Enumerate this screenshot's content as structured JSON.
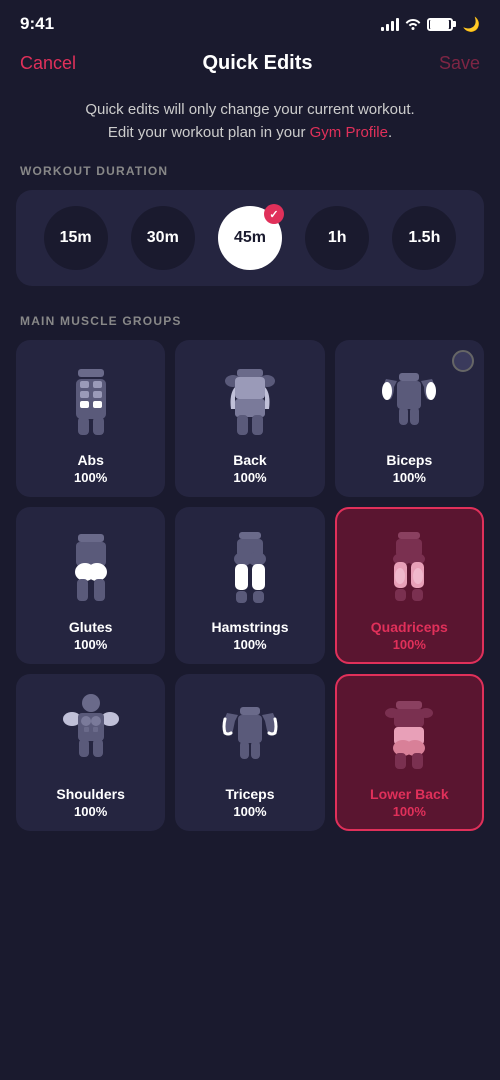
{
  "statusBar": {
    "time": "9:41",
    "moonSymbol": "🌙"
  },
  "nav": {
    "cancelLabel": "Cancel",
    "title": "Quick Edits",
    "saveLabel": "Save"
  },
  "infoText": {
    "line1": "Quick edits will only change your current workout.",
    "line2": "Edit your workout plan in your ",
    "linkText": "Gym Profile",
    "line3": "."
  },
  "workoutDuration": {
    "sectionLabel": "WORKOUT DURATION",
    "options": [
      {
        "label": "15m",
        "active": false
      },
      {
        "label": "30m",
        "active": false
      },
      {
        "label": "45m",
        "active": true
      },
      {
        "label": "1h",
        "active": false
      },
      {
        "label": "1.5h",
        "active": false
      }
    ]
  },
  "mainMuscleGroups": {
    "sectionLabel": "MAIN MUSCLE GROUPS",
    "muscles": [
      {
        "name": "Abs",
        "percent": "100%",
        "selected": false,
        "type": "abs"
      },
      {
        "name": "Back",
        "percent": "100%",
        "selected": false,
        "type": "back"
      },
      {
        "name": "Biceps",
        "percent": "100%",
        "selected": false,
        "type": "biceps",
        "showDot": true
      },
      {
        "name": "Glutes",
        "percent": "100%",
        "selected": false,
        "type": "glutes"
      },
      {
        "name": "Hamstrings",
        "percent": "100%",
        "selected": false,
        "type": "hamstrings"
      },
      {
        "name": "Quadriceps",
        "percent": "100%",
        "selected": true,
        "type": "quadriceps"
      },
      {
        "name": "Shoulders",
        "percent": "100%",
        "selected": false,
        "type": "shoulders"
      },
      {
        "name": "Triceps",
        "percent": "100%",
        "selected": false,
        "type": "triceps"
      },
      {
        "name": "Lower Back",
        "percent": "100%",
        "selected": true,
        "type": "lowerback"
      }
    ]
  }
}
